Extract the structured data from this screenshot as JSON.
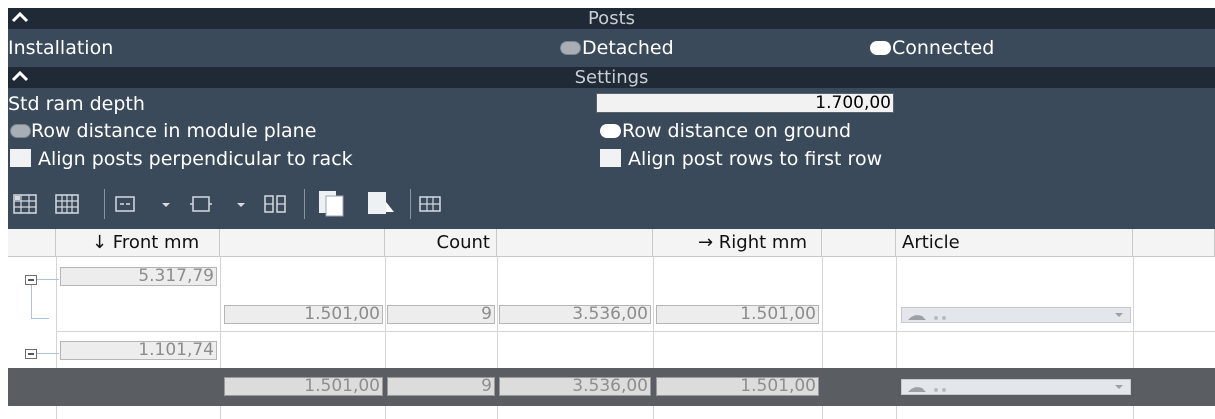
{
  "posts": {
    "title": "Posts",
    "installation_label": "Installation",
    "options": [
      {
        "label": "Detached",
        "selected": false
      },
      {
        "label": "Connected",
        "selected": true
      }
    ]
  },
  "settings": {
    "title": "Settings",
    "std_ram_depth_label": "Std ram depth",
    "std_ram_depth_value": "1.700,00",
    "row_distance_options": [
      {
        "label": "Row distance in module plane",
        "selected": false
      },
      {
        "label": "Row distance on ground",
        "selected": true
      }
    ],
    "checkboxes": [
      {
        "label": "Align posts perpendicular to rack",
        "checked": false
      },
      {
        "label": "Align post rows to first row",
        "checked": false
      }
    ]
  },
  "toolbar": {
    "icons": [
      "grid-icon",
      "table-icon",
      "box-icon",
      "dropdown-icon",
      "rect-icon",
      "dropdown-icon",
      "columns-icon",
      "copy-icon",
      "paste-icon",
      "cells-icon"
    ]
  },
  "table": {
    "headers": [
      "↓ Front mm",
      "",
      "Count",
      "",
      "→ Right mm",
      "",
      "Article",
      ""
    ],
    "rows": [
      {
        "type": "group",
        "front": "5.317,79"
      },
      {
        "type": "item",
        "c1": "1.501,00",
        "count": "9",
        "c3": "3.536,00",
        "right": "1.501,00",
        "article": "R.O."
      },
      {
        "type": "group",
        "front": "1.101,74"
      },
      {
        "type": "item",
        "selected": true,
        "c1": "1.501,00",
        "count": "9",
        "c3": "3.536,00",
        "right": "1.501,00",
        "article": "R.O."
      }
    ]
  },
  "colors": {
    "header_bg": "#1f2a36",
    "panel_bg": "#3b4a5a",
    "selected_row": "#5a5d61"
  }
}
